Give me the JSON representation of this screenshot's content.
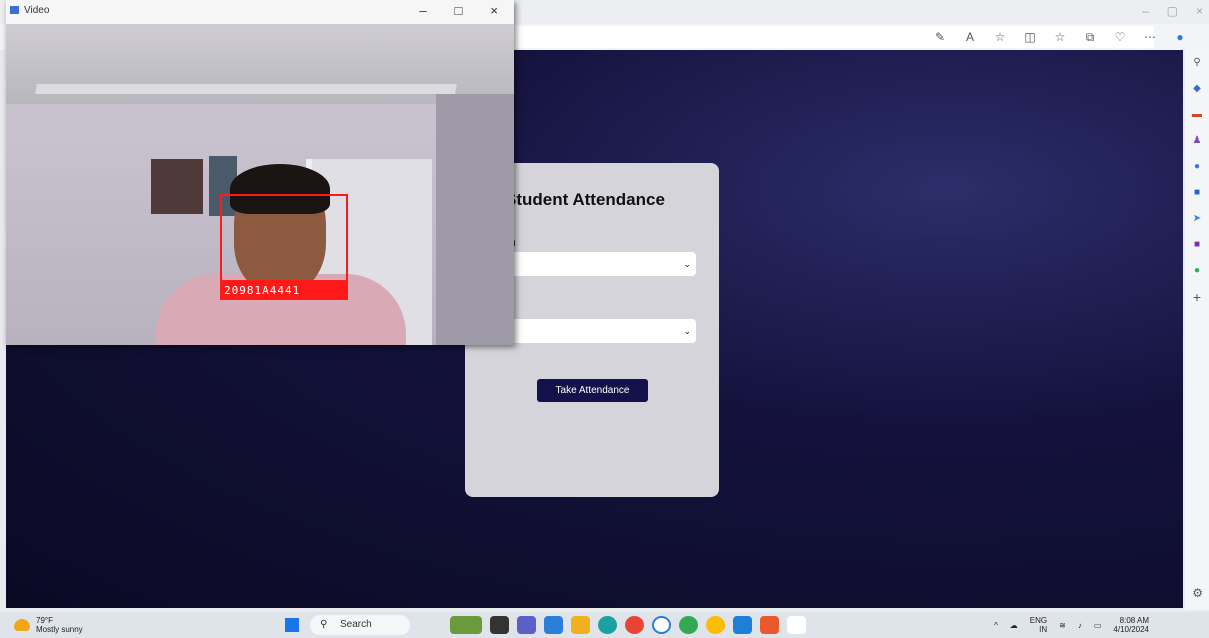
{
  "video_window": {
    "title": "Video",
    "controls": [
      "–",
      "□",
      "×"
    ],
    "face_label": "20981A4441"
  },
  "browser": {
    "toolbar_icons": [
      "pen-icon",
      "read-aloud-icon",
      "star-icon",
      "split-icon",
      "favorites-icon",
      "collections-icon",
      "extensions-icon",
      "more-icon",
      "copilot-icon"
    ],
    "sidebar_icons": [
      "search-icon",
      "tag-icon",
      "toolbox-icon",
      "person-icon",
      "office-icon",
      "outlook-icon",
      "send-icon",
      "onenote-icon",
      "whatsapp-icon",
      "add-icon"
    ],
    "window_controls": [
      "–",
      "▢",
      "×"
    ]
  },
  "card": {
    "title": "Student Attendance",
    "field1_label": "h",
    "field1_value": "",
    "field2_value": "",
    "button_label": "Take Attendance"
  },
  "taskbar": {
    "weather_temp": "79°F",
    "weather_desc": "Mostly sunny",
    "search_label": "Search",
    "lang": "ENG",
    "region": "IN",
    "time": "8:08 AM",
    "date": "4/10/2024"
  }
}
